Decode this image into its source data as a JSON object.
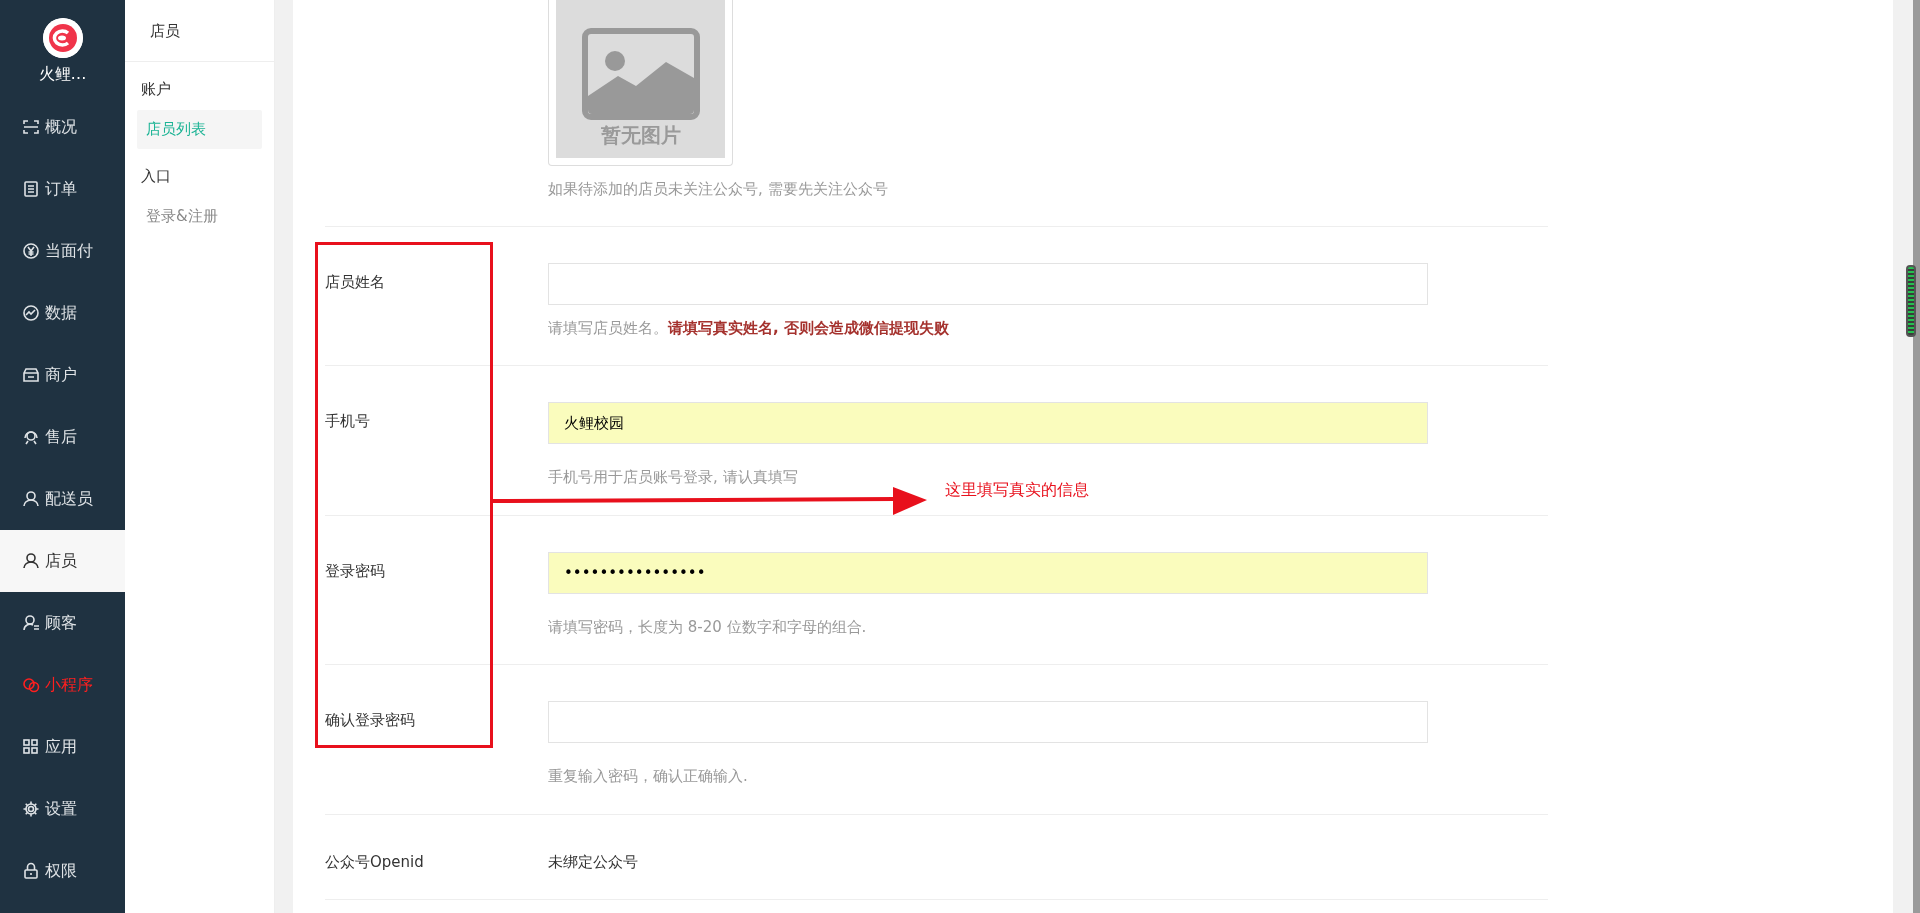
{
  "sidebar": {
    "logo_text": "火鲤…",
    "items": [
      {
        "label": "概况",
        "selected": false,
        "color": "#dfe3e6"
      },
      {
        "label": "订单",
        "selected": false,
        "color": "#dfe3e6"
      },
      {
        "label": "当面付",
        "selected": false,
        "color": "#dfe3e6"
      },
      {
        "label": "数据",
        "selected": false,
        "color": "#dfe3e6"
      },
      {
        "label": "商户",
        "selected": false,
        "color": "#dfe3e6"
      },
      {
        "label": "售后",
        "selected": false,
        "color": "#dfe3e6"
      },
      {
        "label": "配送员",
        "selected": false,
        "color": "#dfe3e6"
      },
      {
        "label": "店员",
        "selected": true,
        "color": "#333333"
      },
      {
        "label": "顾客",
        "selected": false,
        "color": "#dfe3e6"
      },
      {
        "label": "小程序",
        "selected": false,
        "color": "#ff1f1f"
      },
      {
        "label": "应用",
        "selected": false,
        "color": "#dfe3e6"
      },
      {
        "label": "设置",
        "selected": false,
        "color": "#dfe3e6"
      },
      {
        "label": "权限",
        "selected": false,
        "color": "#dfe3e6"
      }
    ]
  },
  "subnav": {
    "title": "店员",
    "groups": [
      {
        "heading": "账户",
        "items": [
          {
            "label": "店员列表",
            "selected": true
          }
        ]
      },
      {
        "heading": "入口",
        "items": [
          {
            "label": "登录&注册",
            "selected": false
          }
        ]
      }
    ]
  },
  "form": {
    "avatar": {
      "placeholder_text": "暂无图片",
      "help": "如果待添加的店员未关注公众号, 需要先关注公众号"
    },
    "fields": [
      {
        "kind": "input",
        "label": "店员姓名",
        "autofilled": false,
        "help": "请填写店员姓名。**请填写真实姓名, 否则会造成微信提现失败**"
      },
      {
        "kind": "input",
        "label": "手机号",
        "value": "火鲤校园",
        "autofilled": true,
        "help": "手机号用于店员账号登录, 请认真填写"
      },
      {
        "kind": "input",
        "label": "登录密码",
        "value": "••••••••••••••••",
        "autofilled": true,
        "help": "请填写密码，长度为 8-20 位数字和字母的组合."
      },
      {
        "kind": "input",
        "label": "确认登录密码",
        "autofilled": false,
        "help": "重复输入密码，确认正确输入."
      },
      {
        "kind": "static",
        "label": "公众号Openid",
        "value": "未绑定公众号"
      }
    ]
  },
  "annotation": {
    "text": "这里填写真实的信息"
  }
}
